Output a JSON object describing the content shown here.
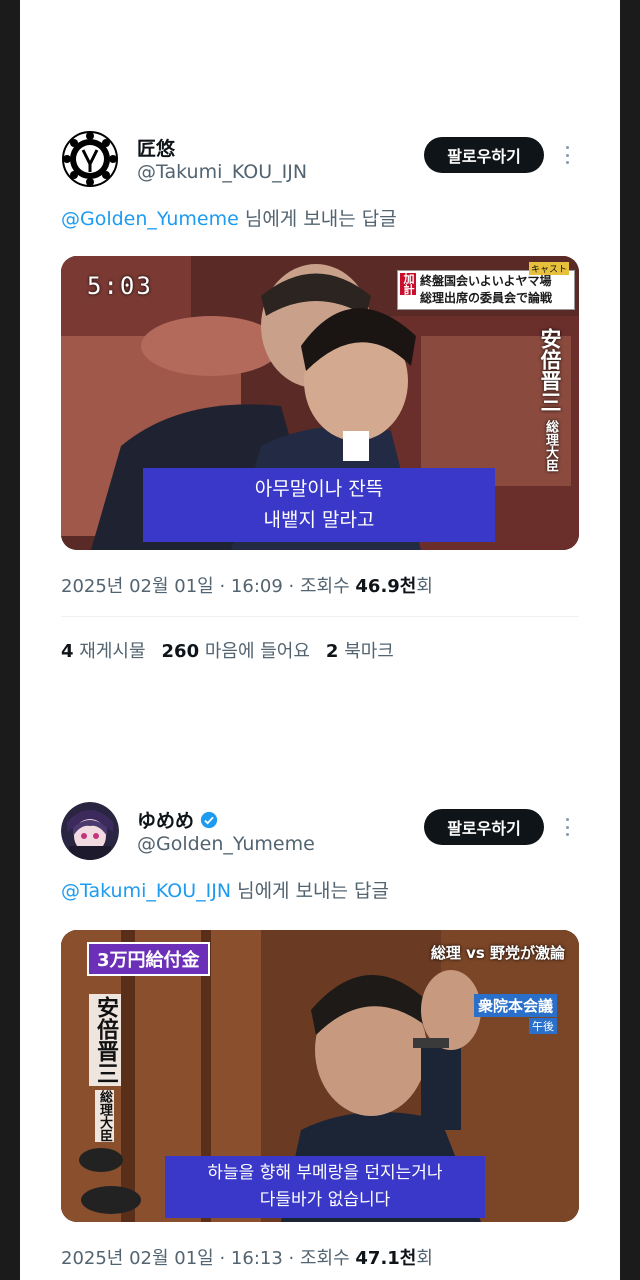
{
  "posts": [
    {
      "author_name": "匠悠",
      "author_handle": "@Takumi_KOU_IJN",
      "verified": false,
      "follow_label": "팔로우하기",
      "reply_mention": "@Golden_Yumeme",
      "reply_suffix": " 님에게 보내는 답글",
      "media": {
        "timestamp": "5:03",
        "banner_prefix": "加計",
        "banner_line1": "終盤国会いよいよヤマ場",
        "banner_line2": "総理出席の委員会で論戦",
        "banner_tag": "キャスト",
        "vertical_name": "安倍晋三",
        "vertical_title": "総理大臣",
        "subtitle_line1": "아무말이나 잔뜩",
        "subtitle_line2": "내뱉지 말라고"
      },
      "date": "2025년 02월 01일",
      "time": "16:09",
      "views_label": "조회수",
      "views_value": "46.9천",
      "views_suffix": "회",
      "stats": {
        "reposts_value": "4",
        "reposts_label": "재게시물",
        "likes_value": "260",
        "likes_label": "마음에 들어요",
        "bookmarks_value": "2",
        "bookmarks_label": "북마크"
      }
    },
    {
      "author_name": "ゆめめ",
      "author_handle": "@Golden_Yumeme",
      "verified": true,
      "follow_label": "팔로우하기",
      "reply_mention": "@Takumi_KOU_IJN",
      "reply_suffix": " 님에게 보내는 답글",
      "media": {
        "badge": "3万円給付金",
        "top_caption": "総理 vs 野党が激論",
        "side_caption": "衆院本会議",
        "side_small": "午後",
        "vertical_name": "安倍晋三",
        "vertical_title": "総理大臣",
        "subtitle_line1": "하늘을 향해 부메랑을 던지는거나",
        "subtitle_line2": "다들바가 없습니다"
      },
      "date": "2025년 02월 01일",
      "time": "16:13",
      "views_label": "조회수",
      "views_value": "47.1천",
      "views_suffix": "회"
    }
  ],
  "colors": {
    "accent": "#1d9bf0",
    "secondary_text": "#536471",
    "primary_text": "#0f1419",
    "follow_bg": "#0f1419",
    "subtitle_bg": "#3a38c9"
  },
  "icons": [
    "more-icon",
    "verified-badge-icon"
  ]
}
